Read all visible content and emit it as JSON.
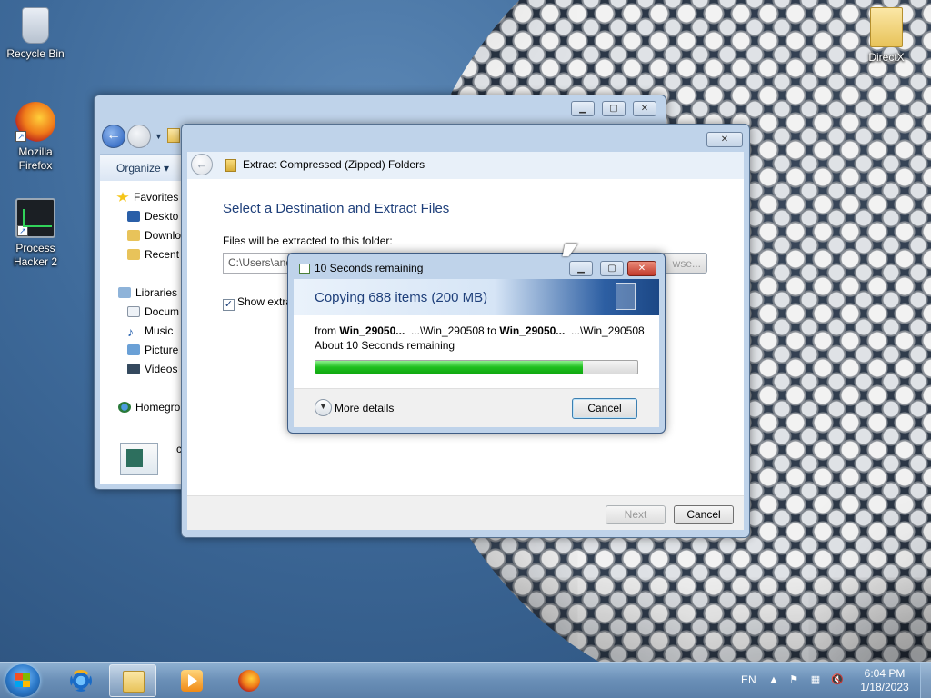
{
  "desktop_icons": {
    "recycle_bin": "Recycle Bin",
    "firefox": "Mozilla Firefox",
    "process_hacker": "Process Hacker 2",
    "directx": "DirectX"
  },
  "explorer": {
    "organize": "Organize",
    "tree": {
      "favorites": "Favorites",
      "desktop": "Deskto",
      "downloads": "Downlo",
      "recent": "Recent",
      "libraries": "Libraries",
      "documents": "Docum",
      "music": "Music",
      "pictures": "Picture",
      "videos": "Videos",
      "homegroup": "Homegro"
    },
    "file_label": "ch"
  },
  "wizard": {
    "title": "Extract Compressed (Zipped) Folders",
    "heading": "Select a Destination and Extract Files",
    "label": "Files will be extracted to this folder:",
    "path_value": "C:\\Users\\and",
    "browse_label": "wse...",
    "show_checkbox": "Show extra",
    "next_label": "Next",
    "cancel_label": "Cancel"
  },
  "copy_dialog": {
    "title": "10 Seconds remaining",
    "heading": "Copying 688 items (200 MB)",
    "from_prefix": "from",
    "source_name": "Win_29050...",
    "source_path": "...\\Win_290508",
    "to_word": "to",
    "dest_name": "Win_29050...",
    "dest_path": "...\\Win_290508",
    "remaining": "About 10 Seconds remaining",
    "progress_percent": 83,
    "more_details": "More details",
    "cancel_label": "Cancel"
  },
  "taskbar": {
    "lang": "EN",
    "time": "6:04 PM",
    "date": "1/18/2023"
  },
  "colors": {
    "accent_blue": "#1e3f7a",
    "progress_green": "#1fbf1f"
  }
}
